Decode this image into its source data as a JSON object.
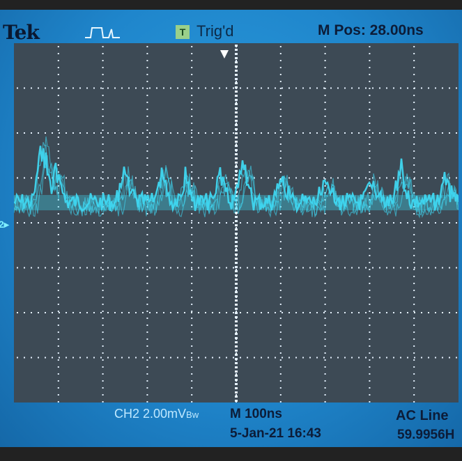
{
  "header": {
    "brand": "Tek",
    "trigger_status": "Trig'd",
    "trigger_badge": "T",
    "horizontal_position": "M Pos: 28.00ns"
  },
  "footer": {
    "channel_scale": "CH2  2.00mV",
    "bandwidth_mark": "Bw",
    "timebase": "M 100ns",
    "date_time": "5-Jan-21 16:43",
    "trigger_source": "AC Line",
    "frequency": "59.9956H"
  },
  "channel_marker": "2",
  "colors": {
    "screen": "#1f86cc",
    "graticule_bg": "#3d4a55",
    "trace": "#3fd6f0",
    "grid_dots": "#e6f2ff"
  }
}
